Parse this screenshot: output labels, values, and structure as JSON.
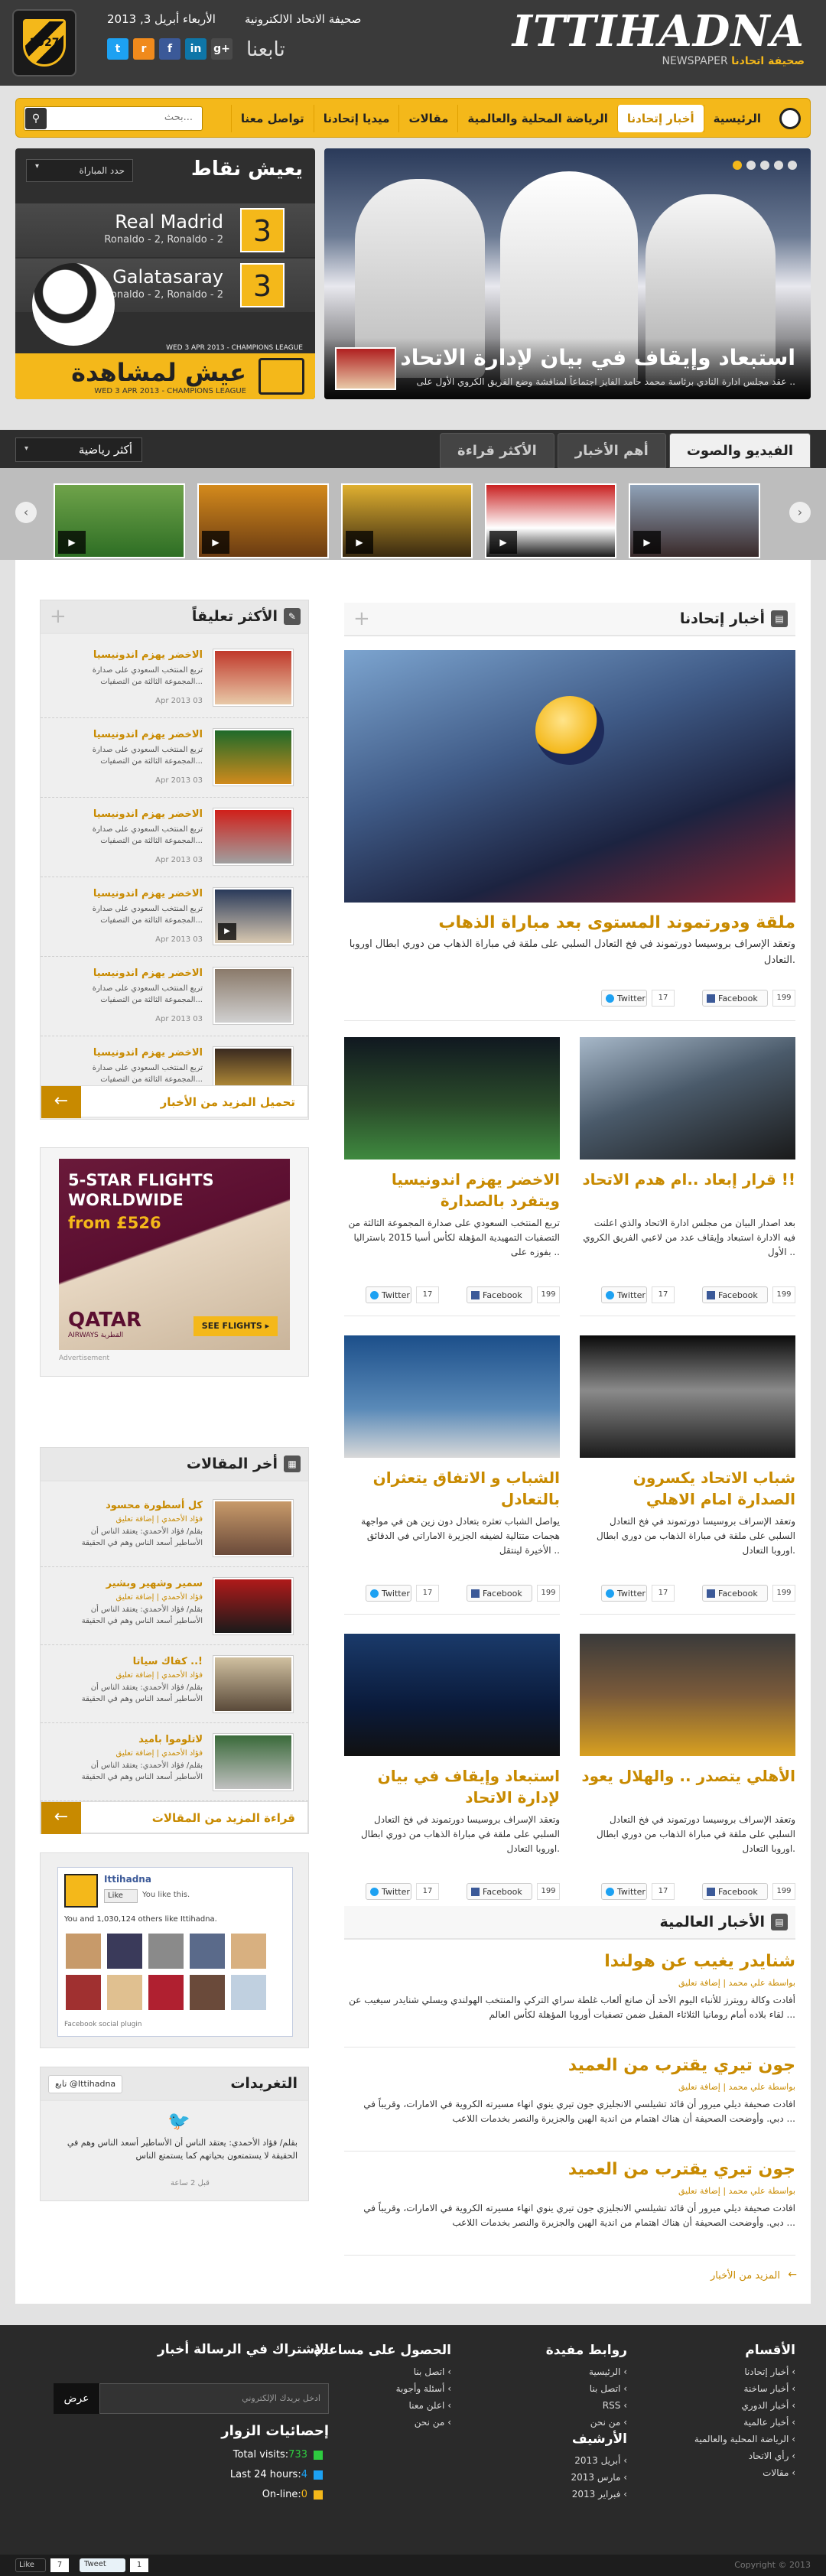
{
  "header": {
    "site_name": "صحيفة الاتحاد الالكترونية",
    "date": "الأربعاء أبريل 3, 2013",
    "follow_label": "تابعنا",
    "logo_main": "ITTIHADNA",
    "logo_sub_en": "NEWSPAPER",
    "logo_sub_ar": "صحيفة اتحادنا",
    "crest_text": "1927",
    "social": [
      {
        "name": "twitter-icon",
        "glyph": "t",
        "color": "#1da1f2"
      },
      {
        "name": "rss-icon",
        "glyph": "r",
        "color": "#f08a1c"
      },
      {
        "name": "facebook-icon",
        "glyph": "f",
        "color": "#3b5998"
      },
      {
        "name": "linkedin-icon",
        "glyph": "in",
        "color": "#0e76a8"
      },
      {
        "name": "google-plus-icon",
        "glyph": "g+",
        "color": "#4a4a4a"
      }
    ]
  },
  "nav": {
    "items": [
      "الرئيسية",
      "أخبار إتحادنا",
      "الرياضة المحلية والعالمية",
      "مقالات",
      "ميديا إتحادنا",
      "تواصل معنا"
    ],
    "active_index": 1,
    "search_placeholder": "بحث...",
    "accent": "#f4b81a"
  },
  "hero": {
    "title": "استبعاد وإيقاف في بيان لإدارة الاتحاد",
    "desc": "عقد مجلس ادارة النادي برئاسة محمد حامد الفايز اجتماعاً لمناقشة وضع الفريق الكروي الأول على ..",
    "slides": 5,
    "active_slide": 0
  },
  "live": {
    "title": "يعيش نقاط",
    "select_label": "حدد المباراة",
    "matches": [
      {
        "team": "Real Madrid",
        "scorers": "Ronaldo - 2, Ronaldo - 2",
        "score": "3"
      },
      {
        "team": "Galatasaray",
        "scorers": "Ronaldo - 2, Ronaldo - 2",
        "score": "3"
      }
    ],
    "match_meta": "WED 3 APR 2013 - CHAMPIONS LEAGUE",
    "watch_title": "عيش لمشاهدة",
    "watch_meta": "WED 3 APR 2013 - CHAMPIONS LEAGUE"
  },
  "media_tabs": {
    "tabs": [
      "الفيديو والصوت",
      "أهم الأخبار",
      "الأكثر قراءة"
    ],
    "active_index": 0,
    "sport_select": "أكثر رياضية",
    "thumbs": [
      {
        "name": "video-thumb-keeper",
        "bg": "linear-gradient(#6fa34a,#2e6e24)"
      },
      {
        "name": "video-thumb-player",
        "bg": "linear-gradient(#d48a1c,#6a3b12)"
      },
      {
        "name": "video-thumb-celebration",
        "bg": "linear-gradient(#e0b030,#3a2a10)"
      },
      {
        "name": "video-thumb-safc",
        "bg": "linear-gradient(#c92020,#fff 60%,#1a1a1a)"
      },
      {
        "name": "video-thumb-crowd",
        "bg": "linear-gradient(#8fa2b8,#3a2a2a)"
      }
    ]
  },
  "news": {
    "section_title": "أخبار إتحادنا",
    "lead": {
      "title": "ملقة ودورتموند المستوى بعد مباراة الذهاب",
      "desc": "وتعقد الإسراف بروسيسا دورتموند في فخ التعادل السلبي على ملقة في مباراة الذهاب من دوري ابطال اوروبا التعادل.",
      "fb": "199",
      "tw": "17"
    },
    "cards": [
      {
        "title": "قرار إبعاد ..ام هدم الاتحاد !!",
        "desc": "بعد اصدار البيان من مجلس ادارة الاتحاد والذي اعلنت فيه الادارة استبعاد وإيقاف عدد من لاعبي الفريق الكروي الأول ..",
        "fb": "199",
        "tw": "17",
        "img": "linear-gradient(160deg,#a7b8c9,#4a5a6a 45%,#1a1a1a)"
      },
      {
        "title": "الاخضر يهزم اندونيسيا ويتفرد بالصدارة",
        "desc": "تربع المنتخب السعودي على صدارة المجموعة الثالثة من التصفيات التمهيدية المؤهلة لكأس أسيا 2015 باستراليا بفوزه على ..",
        "fb": "199",
        "tw": "17",
        "img": "linear-gradient(180deg,#101820 0%,#2a4a2a 55%,#3f8a3f 100%)"
      },
      {
        "title": "شباب الاتحاد يكسرون الصدارة امام الاهلي",
        "desc": "وتعقد الإسراف بروسيسا دورتموند في فخ التعادل السلبي على ملقة في مباراة الذهاب من دوري ابطال اوروبا التعادل.",
        "fb": "199",
        "tw": "17",
        "img": "linear-gradient(180deg,#0a0a0a,#8a8a8a 45%,#1a1a1a)"
      },
      {
        "title": "الشباب و الاتفاق يتعثران بالتعادل",
        "desc": "يواصل الشباب تعثره بتعادل دون زين هن في مواجهة هجمات متتالية لضيفه الجزيرة الاماراتي في الدقائق الأخيرة لينتقل ..",
        "fb": "199",
        "tw": "17",
        "img": "linear-gradient(180deg,#1c4f8a,#5a8ab8 60%,#d9d9d9)"
      },
      {
        "title": "الأهلي يتصدر .. والهلال يعود",
        "desc": "وتعقد الإسراف بروسيسا دورتموند في فخ التعادل السلبي على ملقة في مباراة الذهاب من دوري ابطال اوروبا التعادل.",
        "fb": "199",
        "tw": "17",
        "img": "linear-gradient(180deg,#3a3a3a,#7a5a3a 50%,#d8a020)"
      },
      {
        "title": "استبعاد وإيقاف في بيان لإدارة الاتحاد",
        "desc": "وتعقد الإسراف بروسيسا دورتموند في فخ التعادل السلبي على ملقة في مباراة الذهاب من دوري ابطال اوروبا التعادل.",
        "fb": "199",
        "tw": "17",
        "img": "linear-gradient(180deg,#1a3a6a,#0a1a3a 60%,#111)"
      }
    ],
    "fb_label": "Facebook",
    "tw_label": "Twitter"
  },
  "world": {
    "section_title": "الأخبار العالمية",
    "items": [
      {
        "title": "شنايدر يغيب عن هولندا",
        "meta": "بواسطة علي محمد | إضافة تعليق",
        "desc": "أفادت وكالة رويترز للأنباء اليوم الأحد أن صانع ألعاب غلطة سراي التركي والمنتخب الهولندي ويسلي شنايدر سيغيب عن لقاء بلاده أمام رومانيا الثلاثاء المقبل ضمن تصفيات أوروبا المؤهلة لكأس العالم ..."
      },
      {
        "title": "جون تيري يقترب من العميد",
        "meta": "بواسطة علي محمد | إضافة تعليق",
        "desc": "افادت صحيفة ديلي ميرور أن قائد تشيلسي الانجليزي جون تيري ينوي انهاء مسيرته الكروية في الامارات، وقريباً في دبي. وأوضحت الصحيفة أن هناك اهتمام من اندية الهين والجزيرة والنصر بخدمات اللاعب ..."
      },
      {
        "title": "جون تيري يقترب من العميد",
        "meta": "بواسطة علي محمد | إضافة تعليق",
        "desc": "افادت صحيفة ديلي ميرور أن قائد تشيلسي الانجليزي جون تيري ينوي انهاء مسيرته الكروية في الامارات، وقريباً في دبي. وأوضحت الصحيفة أن هناك اهتمام من اندية الهين والجزيرة والنصر بخدمات اللاعب ..."
      }
    ],
    "more": "المزيد من الأخبار"
  },
  "comments": {
    "section_title": "الأكثر تعليقاً",
    "items": [
      {
        "title": "الاخضر يهزم اندونيسيا",
        "desc": "تربع المنتخب السعودي على صدارة المجموعة الثالثة من التصفيات...",
        "date": "Apr 2013 03",
        "img": "linear-gradient(#c0392b,#e8c9a8)"
      },
      {
        "title": "الاخضر يهزم اندونيسيا",
        "desc": "تربع المنتخب السعودي على صدارة المجموعة الثالثة من التصفيات...",
        "date": "Apr 2013 03",
        "img": "linear-gradient(#1e6a2a,#d08a1c)"
      },
      {
        "title": "الاخضر يهزم اندونيسيا",
        "desc": "تربع المنتخب السعودي على صدارة المجموعة الثالثة من التصفيات...",
        "date": "Apr 2013 03",
        "img": "linear-gradient(#d0201a,#a0a0a0)"
      },
      {
        "title": "الاخضر يهزم اندونيسيا",
        "desc": "تربع المنتخب السعودي على صدارة المجموعة الثالثة من التصفيات...",
        "date": "Apr 2013 03",
        "img": "linear-gradient(#2a3a5a,#d8c8b0)"
      },
      {
        "title": "الاخضر يهزم اندونيسيا",
        "desc": "تربع المنتخب السعودي على صدارة المجموعة الثالثة من التصفيات...",
        "date": "Apr 2013 03",
        "img": "linear-gradient(#8a7a6a,#d0d0d0)"
      },
      {
        "title": "الاخضر يهزم اندونيسيا",
        "desc": "تربع المنتخب السعودي على صدارة المجموعة الثالثة من التصفيات...",
        "date": "Apr 2013 03",
        "img": "linear-gradient(#3a2a20,#e0b040)"
      }
    ],
    "more": "تحميل المزيد من الأخبار"
  },
  "ad": {
    "line1": "5-STAR FLIGHTS",
    "line2": "WORLDWIDE",
    "line3": "from £526",
    "brand": "QATAR",
    "brand_sub": "AIRWAYS القطرية",
    "cta": "SEE FLIGHTS ▸",
    "label": "Advertisement"
  },
  "articles": {
    "section_title": "أخر المقالات",
    "items": [
      {
        "title": "كل أسطورة محسود",
        "meta": "فؤاد الأحمدي | إضافة تعليق",
        "desc": "بقلم/ فؤاد الأحمدي: يعتقد الناس أن الأساطير أسعد الناس وهم في الحقيقة",
        "img": "linear-gradient(#c89a6a,#6a4a3a)"
      },
      {
        "title": "سمير وشهير وبشير",
        "meta": "فؤاد الأحمدي | إضافة تعليق",
        "desc": "بقلم/ فؤاد الأحمدي: يعتقد الناس أن الأساطير أسعد الناس وهم في الحقيقة",
        "img": "linear-gradient(#b01a1a,#1a1a1a)"
      },
      {
        "title": "كفاك سياتا ..!",
        "meta": "فؤاد الأحمدي | إضافة تعليق",
        "desc": "بقلم/ فؤاد الأحمدي: يعتقد الناس أن الأساطير أسعد الناس وهم في الحقيقة",
        "img": "linear-gradient(#d0c0a0,#5a4a3a)"
      },
      {
        "title": "لاتلوموا باميد",
        "meta": "فؤاد الأحمدي | إضافة تعليق",
        "desc": "بقلم/ فؤاد الأحمدي: يعتقد الناس أن الأساطير أسعد الناس وهم في الحقيقة",
        "img": "linear-gradient(#3a6a3a,#c0c0c0)"
      }
    ],
    "more": "قراءة المزيد من المقالات"
  },
  "fb_widget": {
    "page_name": "Ittihadna",
    "like_label": "Like",
    "like_text": "You like this.",
    "others_text": "You and 1,030,124 others like Ittihadna.",
    "plugin": "Facebook social plugin",
    "faces": [
      "#c79a6a",
      "#3a3a5a",
      "#8a8a8a",
      "#5a6a8a",
      "#d8b080",
      "#a03030",
      "#e0c090",
      "#b02030",
      "#6a4a3a",
      "#c0d0e0"
    ]
  },
  "tweets": {
    "section_title": "التغريدات",
    "follow": "تابع @Ittihadna",
    "text": "بقلم/ فؤاد الأحمدي: يعتقد الناس أن الأساطير أسعد الناس وهم في الحقيقة لا يستمتعون بحياتهم كما يستمتع الناس",
    "time": "قبل 2 ساعة"
  },
  "footer": {
    "cols": [
      {
        "title": "الأقسام",
        "items": [
          "أخبار إتحادنا",
          "أخبار ساخنة",
          "أخبار الدوري",
          "أخبار عالمية",
          "الرياضة المحلية والعالمية",
          "رأي الاتحاد",
          "مقالات"
        ]
      },
      {
        "title": "روابط مفيدة",
        "items": [
          "الرئيسية",
          "اتصل بنا",
          "RSS",
          "من نحن"
        ]
      },
      {
        "title": "الأرشيف",
        "items": [
          "أبريل 2013",
          "مارس 2013",
          "فبراير 2013"
        ]
      },
      {
        "title": "الحصول على مساعدة",
        "items": [
          "اتصل بنا",
          "أسئلة وأجوبة",
          "اعلن معنا",
          "من نحن"
        ]
      }
    ],
    "newsletter_title": "الإشتراك في الرسالة أخبار",
    "newsletter_placeholder": "ادخل بريدك الإلكتروني",
    "newsletter_button": "عرض",
    "stats_title": "إحصائيات الزوار",
    "stats": [
      {
        "label": "Total visits:",
        "value": "733",
        "color": "#2ecc40"
      },
      {
        "label": "Last 24 hours:",
        "value": "4",
        "color": "#1da1f2"
      },
      {
        "label": "On-line:",
        "value": "0",
        "color": "#f4b81a"
      }
    ],
    "copyright": "Copyright © 2013",
    "like_label": "Like",
    "like_count": "7",
    "tweet_label": "Tweet",
    "tweet_count": "1"
  }
}
